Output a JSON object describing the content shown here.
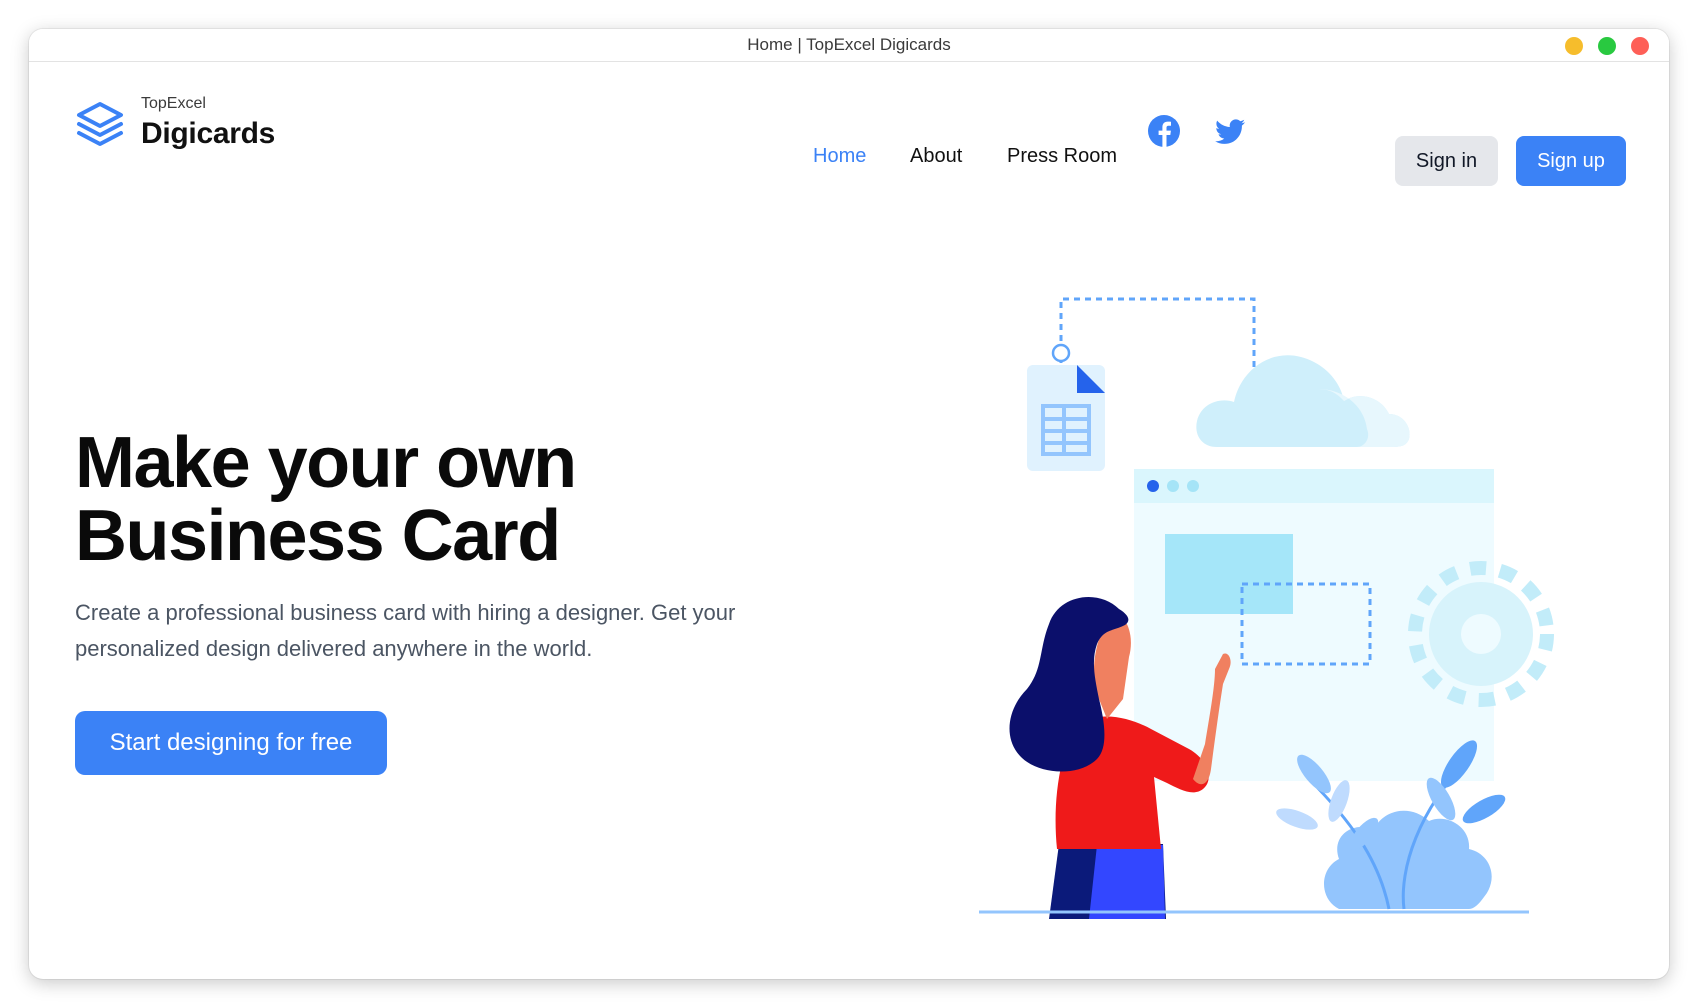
{
  "window": {
    "title": "Home | TopExcel Digicards"
  },
  "brand": {
    "small": "TopExcel",
    "name": "Digicards",
    "icon": "layers-icon"
  },
  "nav": {
    "items": [
      {
        "label": "Home",
        "active": true
      },
      {
        "label": "About",
        "active": false
      },
      {
        "label": "Press Room",
        "active": false
      }
    ],
    "social": [
      "facebook-icon",
      "twitter-icon"
    ]
  },
  "auth": {
    "sign_in": "Sign in",
    "sign_up": "Sign up"
  },
  "hero": {
    "title_line1": "Make your own",
    "title_line2": "Business Card",
    "subtitle": "Create a professional business card with hiring a designer. Get your personalized design delivered anywhere in the world.",
    "cta": "Start designing for free"
  },
  "colors": {
    "accent": "#3b82f6",
    "secondary_button": "#e5e7eb",
    "heading": "#0a0a0a",
    "body_text": "#4b5563"
  }
}
